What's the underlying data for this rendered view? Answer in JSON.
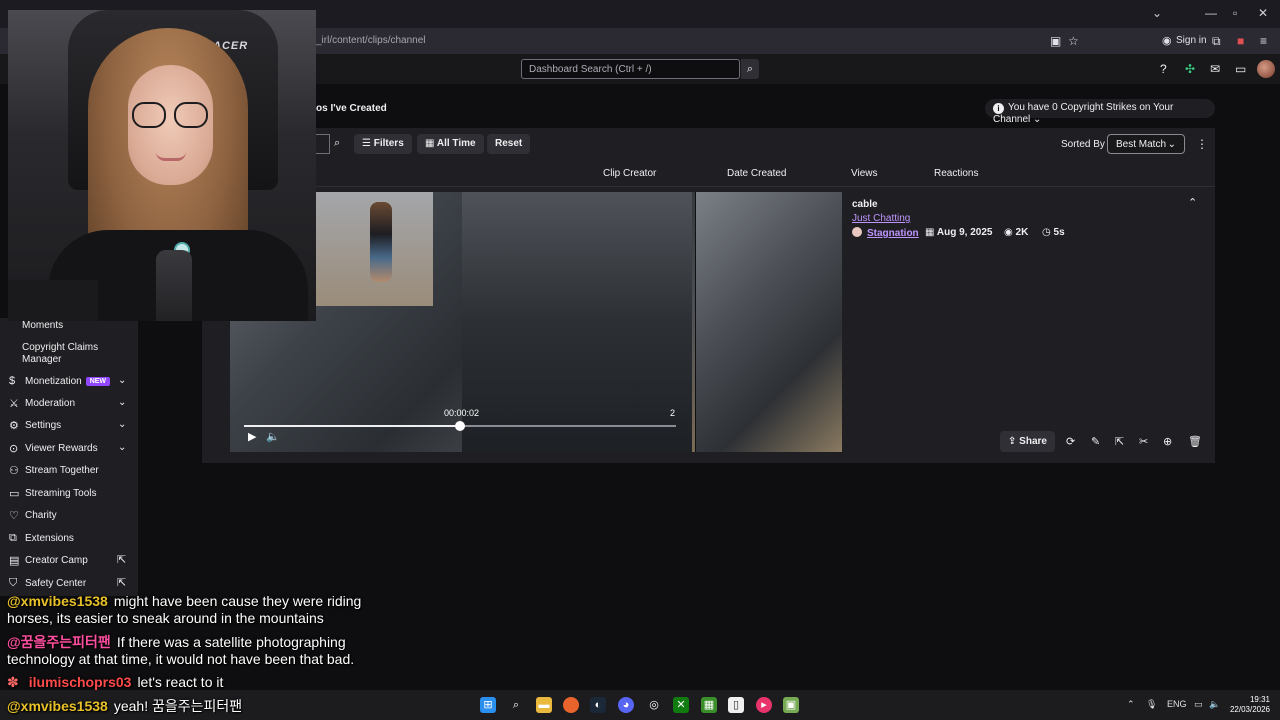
{
  "browser": {
    "url": "_irl/content/clips/channel",
    "sign_in": "Sign in"
  },
  "topbar": {
    "search_placeholder": "Dashboard Search (Ctrl + /)"
  },
  "page": {
    "title_partial": "os I've Created",
    "strikes": "You have 0 Copyright Strikes on Your Channel"
  },
  "filters": {
    "filters_label": "Filters",
    "time_label": "All Time",
    "reset_label": "Reset",
    "sorted_by_label": "Sorted By",
    "sort_value": "Best Match"
  },
  "columns": [
    "Clip Creator",
    "Date Created",
    "Views",
    "Reactions"
  ],
  "clip": {
    "title": "cable",
    "category": "Just Chatting",
    "creator": "Stagnation",
    "date": "Aug 9, 2025",
    "views": "2K",
    "duration": "5s",
    "timecode": "00:00:02",
    "end_marker": "2",
    "progress": 0.5,
    "share_label": "Share"
  },
  "webcam": {
    "chair_brand": "ACER"
  },
  "sidebar": {
    "items": [
      {
        "label": "Moments",
        "sub": true
      },
      {
        "label": "Copyright Claims",
        "label2": "Manager",
        "sub": true
      },
      {
        "label": "Monetization",
        "badge": "NEW",
        "icon": "dollar-icon",
        "chevron": true
      },
      {
        "label": "Moderation",
        "icon": "sword-icon",
        "chevron": true
      },
      {
        "label": "Settings",
        "icon": "gear-icon",
        "chevron": true
      },
      {
        "label": "Viewer Rewards",
        "icon": "reward-icon",
        "chevron": true
      },
      {
        "label": "Stream Together",
        "icon": "people-icon"
      },
      {
        "label": "Streaming Tools",
        "icon": "camera-icon"
      },
      {
        "label": "Charity",
        "icon": "heart-icon"
      },
      {
        "label": "Extensions",
        "icon": "puzzle-icon"
      },
      {
        "label": "Creator Camp",
        "icon": "book-icon",
        "external": true
      },
      {
        "label": "Safety Center",
        "icon": "shield-icon",
        "external": true
      }
    ]
  },
  "chat": [
    {
      "user": "@xmvibes1538",
      "color": "#e8c02a",
      "text": "might have been cause they were riding",
      "text2": "horses, its easier to sneak around in the mountains"
    },
    {
      "user": "@꿈을주는피터팬",
      "color": "#ff4fa0",
      "text": "If there was a satellite photographing",
      "text2": "technology at that time, it would not have been that bad."
    },
    {
      "user": "ilumischoprs03",
      "color": "#ff4a4a",
      "text": "let's react to it",
      "badge": "✽"
    },
    {
      "user": "@xmvibes1538",
      "color": "#e8c02a",
      "text": "yeah! 꿈을주는피터팬"
    }
  ],
  "taskbar": {
    "lang": "ENG",
    "time": "19:31",
    "date": "22/03/2026"
  },
  "colors": {
    "accent": "#9147ff",
    "link": "#bf94ff"
  }
}
